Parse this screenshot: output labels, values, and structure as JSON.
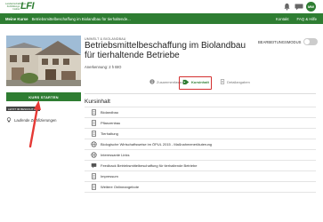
{
  "header": {
    "logo_small_text": "Landwirtschaftliches Fortbildungs Institut",
    "logo_mark": "LFI",
    "avatar_initials": "MW"
  },
  "nav": {
    "my_courses": "Meine Kurse",
    "breadcrumb": "Betriebsmittelbeschaffung im Biolandbau für tierhaltende...",
    "contact": "Kontakt",
    "faq": "FAQ & Hilfe"
  },
  "course": {
    "category": "UMWELT & BIOLANDBAU",
    "title": "Betriebsmittelbeschaffung im Biolandbau für tierhaltende Betriebe",
    "credits": "Anerkennung: 2 h BIO",
    "edit_mode_label": "BEARBEITUNGSMODUS",
    "start_button": "KURS STARTEN",
    "last_visit": "LETZT IM BESUCHT AM",
    "certificates": "Laufende Zertifizierungen"
  },
  "tabs": [
    {
      "label": "Zusammenfassung",
      "icon": "info-icon"
    },
    {
      "label": "Kursinhalt",
      "icon": "tag-icon",
      "active": true
    },
    {
      "label": "Detailangaben",
      "icon": "document-icon"
    }
  ],
  "content": {
    "section_title": "Kursinhalt",
    "items": [
      {
        "label": "Biolandbau",
        "icon": "document-icon"
      },
      {
        "label": "Pflanzenbau",
        "icon": "document-icon"
      },
      {
        "label": "Tierhaltung",
        "icon": "document-icon"
      },
      {
        "label": "Biologische Wirtschaftsweise im ÖPUL 2015 - Maßnahmenerläuterung",
        "icon": "globe-icon"
      },
      {
        "label": "Interessante Links",
        "icon": "globe-icon"
      },
      {
        "label": "Feedback Betriebsmittelbeschaffung für tierhaltende Betriebe",
        "icon": "feedback-icon"
      },
      {
        "label": "Impressum",
        "icon": "document-icon"
      },
      {
        "label": "Weitere Onlineangebote",
        "icon": "document-icon"
      }
    ]
  },
  "colors": {
    "brand_green": "#2e7d32",
    "highlight_red": "#d32f2f",
    "arrow_red": "#e53935"
  }
}
